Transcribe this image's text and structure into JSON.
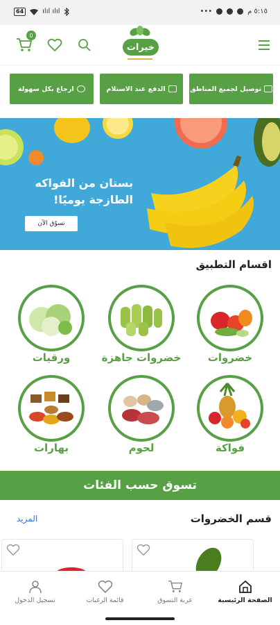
{
  "status_bar": {
    "left_badge": "64",
    "signal": "ılıl ılıl",
    "time": "٥:١٥ م"
  },
  "header": {
    "cart_count": "0",
    "logo_text": "خيرات",
    "icons": [
      "menu-icon",
      "search-icon",
      "heart-icon",
      "cart-icon"
    ]
  },
  "features": [
    {
      "label": "توصيل لجميع المناطق"
    },
    {
      "label": "الدفع عند الاستلام"
    },
    {
      "label": "ارجاع بكل سهولة"
    }
  ],
  "banner": {
    "line1": "بستان من الفواكه",
    "line2": "الطازجة يوميًا!",
    "cta": "تسوّق الآن"
  },
  "categories_section": {
    "title": "اقسام التطبيق",
    "items": [
      {
        "label": "خضروات"
      },
      {
        "label": "خضروات جاهزة"
      },
      {
        "label": "ورقيات"
      },
      {
        "label": "فواكة"
      },
      {
        "label": "لحوم"
      },
      {
        "label": "بهارات"
      }
    ]
  },
  "shop_by_category": "تسوق حسب الفئات",
  "vegetables_section": {
    "title": "قسم الخضروات",
    "more": "المزيد"
  },
  "bottom_nav": [
    {
      "label": "الصفحة الرئيسية"
    },
    {
      "label": "عربة التسوق"
    },
    {
      "label": "قائمة الرغبات"
    },
    {
      "label": "تسجيل الدخول"
    }
  ],
  "colors": {
    "brand_green": "#58a045",
    "banner_blue": "#41a9d9",
    "link_blue": "#3b73c8"
  }
}
